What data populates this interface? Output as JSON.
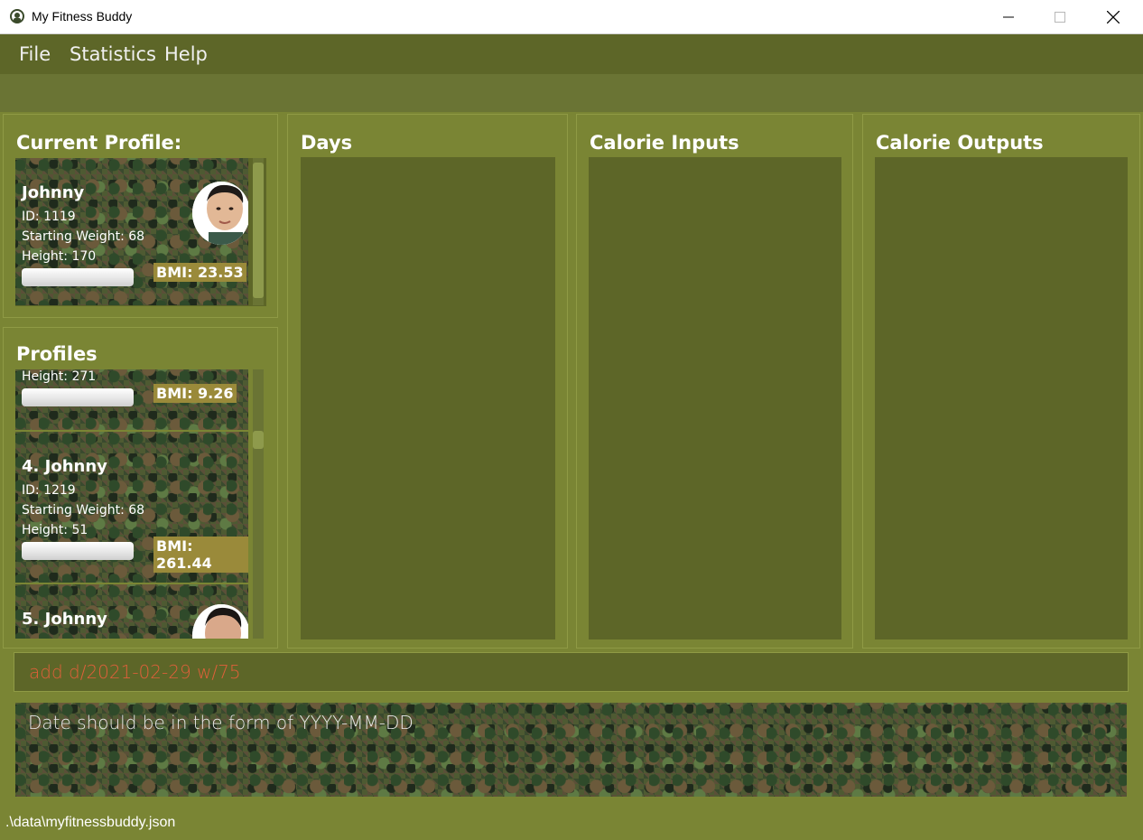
{
  "window": {
    "title": "My Fitness Buddy"
  },
  "menu": {
    "items": [
      "File",
      "Statistics",
      "Help"
    ]
  },
  "current_profile": {
    "title": "Current Profile:",
    "card": {
      "name": "Johnny",
      "id": "ID: 1119",
      "starting_weight": "Starting Weight: 68",
      "height": "Height: 170",
      "bmi": "BMI: 23.53"
    }
  },
  "profiles": {
    "title": "Profiles",
    "partial_card": {
      "height": "Height: 271",
      "bmi": "BMI: 9.26"
    },
    "card4": {
      "name": "4.  Johnny",
      "id": "ID: 1219",
      "starting_weight": "Starting Weight: 68",
      "height": "Height: 51",
      "bmi": "BMI: 261.44"
    },
    "card5": {
      "name": "5.  Johnny"
    }
  },
  "days": {
    "title": "Days"
  },
  "calorie_inputs": {
    "title": "Calorie Inputs"
  },
  "calorie_outputs": {
    "title": "Calorie Outputs"
  },
  "command": {
    "value": "add d/2021-02-29 w/75"
  },
  "result": {
    "text": "Date should be in the form of YYYY-MM-DD"
  },
  "status": {
    "path": ".\\data\\myfitnessbuddy.json"
  },
  "colors": {
    "panel": "#7a8534",
    "panel_dark": "#5d6628",
    "command_text": "#e0603a",
    "bmi_badge": "#9a8a3a"
  }
}
